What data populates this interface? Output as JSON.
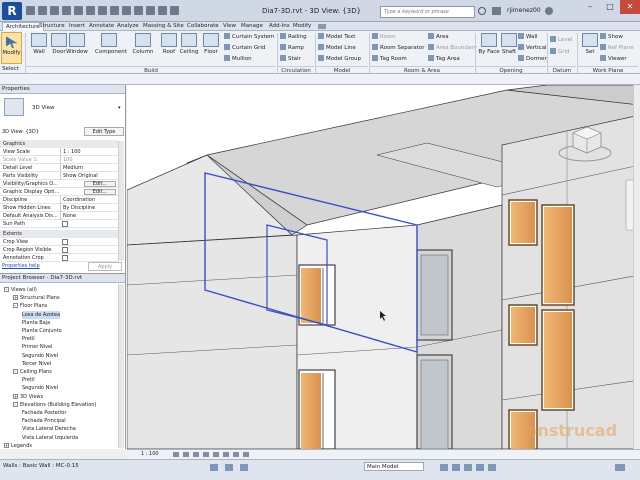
{
  "app": {
    "logo": "R",
    "title": "Dia7-3D.rvt - 3D View: {3D}",
    "search_placeholder": "Type a keyword or phrase",
    "user": "rjimenez00"
  },
  "tabs": [
    "Architecture",
    "Structure",
    "Insert",
    "Annotate",
    "Analyze",
    "Massing & Site",
    "Collaborate",
    "View",
    "Manage",
    "Add-Ins",
    "Modify"
  ],
  "ribbon": {
    "modify": "Modify",
    "select": "Select",
    "build_tools": [
      "Wall",
      "Door",
      "Window",
      "Component",
      "Column",
      "Roof",
      "Ceiling",
      "Floor"
    ],
    "curtain": [
      "Curtain System",
      "Curtain Grid",
      "Mullion"
    ],
    "circulation": [
      "Railing",
      "Ramp",
      "Stair"
    ],
    "model": [
      "Model Text",
      "Model Line",
      "Model Group"
    ],
    "room_area": [
      "Room",
      "Room Separator",
      "Tag Room",
      "Area",
      "Area Boundary",
      "Tag Area"
    ],
    "opening": [
      "By Face",
      "Shaft",
      "Wall",
      "Vertical",
      "Dormer"
    ],
    "datum": [
      "Level",
      "Grid"
    ],
    "work_plane": [
      "Set",
      "Show",
      "Ref Plane",
      "Viewer"
    ],
    "groups": [
      "Build",
      "Circulation",
      "Model",
      "Room & Area",
      "Opening",
      "Datum",
      "Work Plane"
    ]
  },
  "properties": {
    "header": "Properties",
    "type_name": "3D View",
    "instance": "3D View: {3D}",
    "edit_type": "Edit Type",
    "graphics_section": "Graphics",
    "rows": [
      {
        "k": "View Scale",
        "v": "1 : 100"
      },
      {
        "k": "Scale Value    1:",
        "v": "100"
      },
      {
        "k": "Detail Level",
        "v": "Medium"
      },
      {
        "k": "Parts Visibility",
        "v": "Show Original"
      },
      {
        "k": "Visibility/Graphics O...",
        "v": "Edit..."
      },
      {
        "k": "Graphic Display Opti...",
        "v": "Edit..."
      },
      {
        "k": "Discipline",
        "v": "Coordination"
      },
      {
        "k": "Show Hidden Lines",
        "v": "By Discipline"
      },
      {
        "k": "Default Analysis Dis...",
        "v": "None"
      },
      {
        "k": "Sun Path",
        "v": ""
      }
    ],
    "extents_section": "Extents",
    "extent_rows": [
      "Crop View",
      "Crop Region Visible",
      "Annotation Crop"
    ],
    "help": "Properties help",
    "apply": "Apply"
  },
  "browser": {
    "header": "Project Browser - Dia7-3D.rvt",
    "items": [
      {
        "t": "Views (all)",
        "lvl": 0,
        "tg": "-"
      },
      {
        "t": "Structural Plans",
        "lvl": 1,
        "tg": "+"
      },
      {
        "t": "Floor Plans",
        "lvl": 1,
        "tg": "-"
      },
      {
        "t": "Losa de Azotea",
        "lvl": 2,
        "tg": ""
      },
      {
        "t": "Planta Baja",
        "lvl": 2,
        "tg": ""
      },
      {
        "t": "Planta Conjunto",
        "lvl": 2,
        "tg": ""
      },
      {
        "t": "Pretil",
        "lvl": 2,
        "tg": ""
      },
      {
        "t": "Primer Nivel",
        "lvl": 2,
        "tg": ""
      },
      {
        "t": "Segundo Nivel",
        "lvl": 2,
        "tg": ""
      },
      {
        "t": "Tercer Nivel",
        "lvl": 2,
        "tg": ""
      },
      {
        "t": "Ceiling Plans",
        "lvl": 1,
        "tg": "-"
      },
      {
        "t": "Pretil",
        "lvl": 2,
        "tg": ""
      },
      {
        "t": "Segundo Nivel",
        "lvl": 2,
        "tg": ""
      },
      {
        "t": "3D Views",
        "lvl": 1,
        "tg": "+"
      },
      {
        "t": "Elevations (Building Elevation)",
        "lvl": 1,
        "tg": "-"
      },
      {
        "t": "Fachada Posterior",
        "lvl": 2,
        "tg": ""
      },
      {
        "t": "Fachada Principal",
        "lvl": 2,
        "tg": ""
      },
      {
        "t": "Vista Lateral Derecha",
        "lvl": 2,
        "tg": ""
      },
      {
        "t": "Vista Lateral Izquierda",
        "lvl": 2,
        "tg": ""
      },
      {
        "t": "Legends",
        "lvl": 0,
        "tg": "+"
      }
    ]
  },
  "viewport": {
    "scale": "1 : 100",
    "watermark": "construcad"
  },
  "status": {
    "message": "Walls : Basic Wall : MC-0.15",
    "workset": "Main Model"
  },
  "colors": {
    "accent": "#1b4f9c",
    "glass": "#e9a866",
    "frame": "#7a5a2c",
    "wall": "#e4e4e4",
    "roof": "#d0d0d0"
  }
}
